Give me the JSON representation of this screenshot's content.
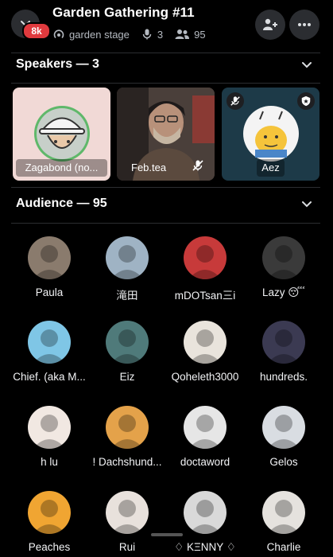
{
  "header": {
    "badge": "8k",
    "title": "Garden Gathering #11",
    "stage_name": "garden stage",
    "speaker_count": "3",
    "listener_count": "95"
  },
  "speakers": {
    "title": "Speakers — 3",
    "items": [
      {
        "name": "Zagabond (no..."
      },
      {
        "name": "Feb.tea"
      },
      {
        "name": "Aez"
      }
    ]
  },
  "audience": {
    "title": "Audience — 95",
    "items": [
      {
        "name": "Paula",
        "color": "#8a7b6d"
      },
      {
        "name": "滝田",
        "color": "#9fb3c4"
      },
      {
        "name": "mDOTsan三i",
        "color": "#c73a3a"
      },
      {
        "name": "Lazy 😴",
        "color": "#3a3a3a"
      },
      {
        "name": "Chief. (aka M...",
        "color": "#7fc6e6"
      },
      {
        "name": "Eiz",
        "color": "#4f7a7a"
      },
      {
        "name": "Qoheleth3000",
        "color": "#e9e4dc"
      },
      {
        "name": "hundreds.",
        "color": "#3b3a52"
      },
      {
        "name": "h lu",
        "color": "#f1e8e2"
      },
      {
        "name": "! Dachshund...",
        "color": "#e4a24a"
      },
      {
        "name": "doctaword",
        "color": "#e6e6e6"
      },
      {
        "name": "Gelos",
        "color": "#d9dde2"
      },
      {
        "name": "Peaches",
        "color": "#f0a532"
      },
      {
        "name": "Rui",
        "color": "#e8e1dc"
      },
      {
        "name": "♢ KΞNNY ♢",
        "color": "#d9d9d9"
      },
      {
        "name": "Charlie",
        "color": "#e5e2de"
      }
    ]
  }
}
